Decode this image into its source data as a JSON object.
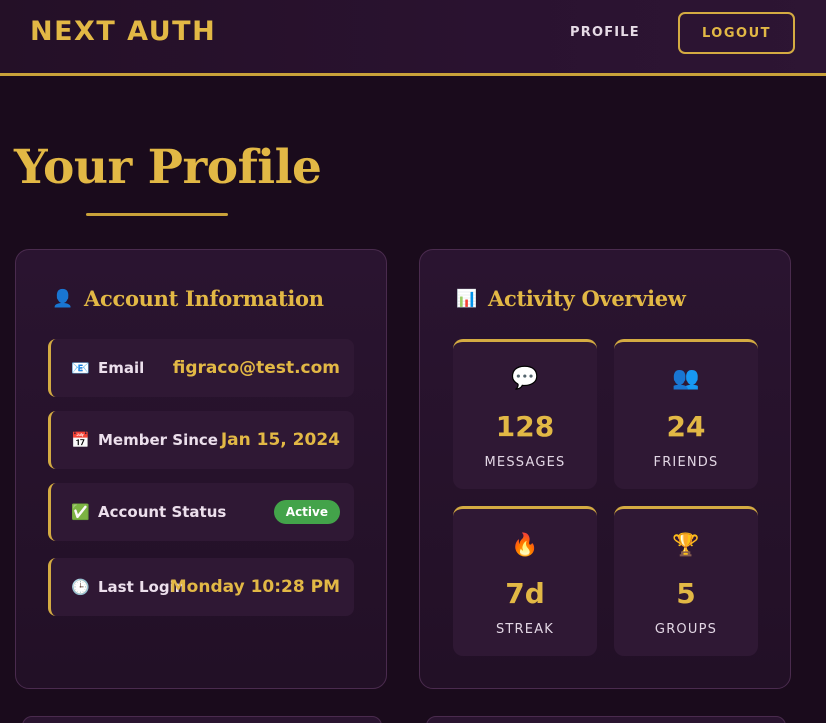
{
  "navbar": {
    "brand": "NEXT AUTH",
    "profile_link": "PROFILE",
    "logout_label": "LOGOUT"
  },
  "page": {
    "title": "Your Profile"
  },
  "account": {
    "heading": "Account Information",
    "heading_icon": "👤",
    "rows": [
      {
        "icon": "📧",
        "icon_name": "email-icon",
        "label": "Email",
        "value": "figraco@test.com"
      },
      {
        "icon": "📅",
        "icon_name": "calendar-icon",
        "label": "Member Since",
        "value": "Jan 15, 2024"
      },
      {
        "icon": "✅",
        "icon_name": "check-icon",
        "label": "Account Status",
        "value": "Active"
      },
      {
        "icon": "🕒",
        "icon_name": "clock-icon",
        "label": "Last Login",
        "value": "Monday 10:28 PM"
      }
    ]
  },
  "activity": {
    "heading": "Activity Overview",
    "heading_icon": "📊",
    "stats": [
      {
        "icon": "💬",
        "icon_name": "speech-bubble-icon",
        "value": "128",
        "label": "MESSAGES"
      },
      {
        "icon": "👥",
        "icon_name": "users-icon",
        "value": "24",
        "label": "FRIENDS"
      },
      {
        "icon": "🔥",
        "icon_name": "fire-icon",
        "value": "7d",
        "label": "STREAK"
      },
      {
        "icon": "🏆",
        "icon_name": "trophy-icon",
        "value": "5",
        "label": "GROUPS"
      }
    ]
  },
  "colors": {
    "accent": "#e2b845",
    "background": "#1a0b1c",
    "card": "#2a1430",
    "status_active": "#43a34a"
  }
}
